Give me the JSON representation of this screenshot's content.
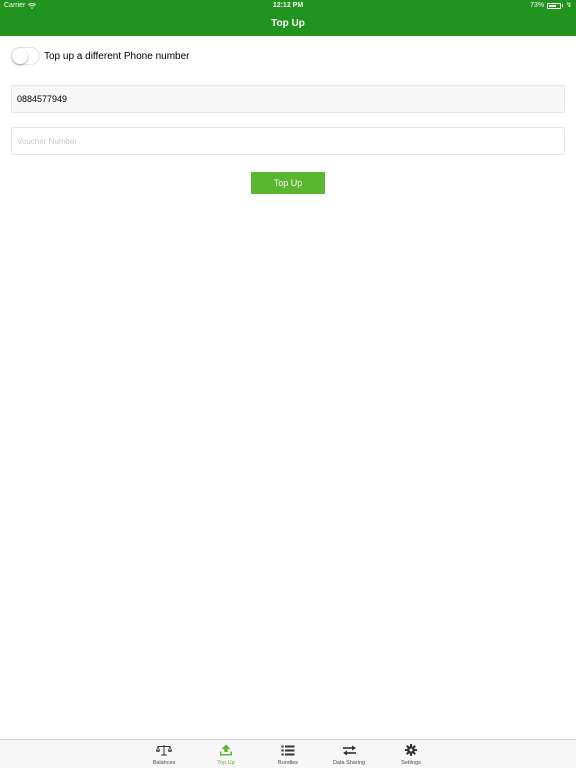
{
  "status_bar": {
    "carrier": "Carrier",
    "time": "12:12 PM",
    "battery_text": "73%",
    "battery_level": 0.73,
    "charging_glyph": "↯"
  },
  "nav": {
    "title": "Top Up"
  },
  "form": {
    "toggle_label": "Top up a different Phone number",
    "toggle_on": false,
    "phone_value": "0884577949",
    "voucher_placeholder": "Voucher Number",
    "submit_label": "Top Up"
  },
  "tabs": [
    {
      "label": "Balances",
      "icon": "scale-icon",
      "active": false
    },
    {
      "label": "Top Up",
      "icon": "upload-icon",
      "active": true
    },
    {
      "label": "Bundles",
      "icon": "list-icon",
      "active": false
    },
    {
      "label": "Data Sharing",
      "icon": "swap-arrows-icon",
      "active": false
    },
    {
      "label": "Settings",
      "icon": "gear-icon",
      "active": false
    }
  ],
  "colors": {
    "header": "#21931f",
    "accent": "#5ab52f",
    "tab_inactive": "#4a4a4a"
  }
}
